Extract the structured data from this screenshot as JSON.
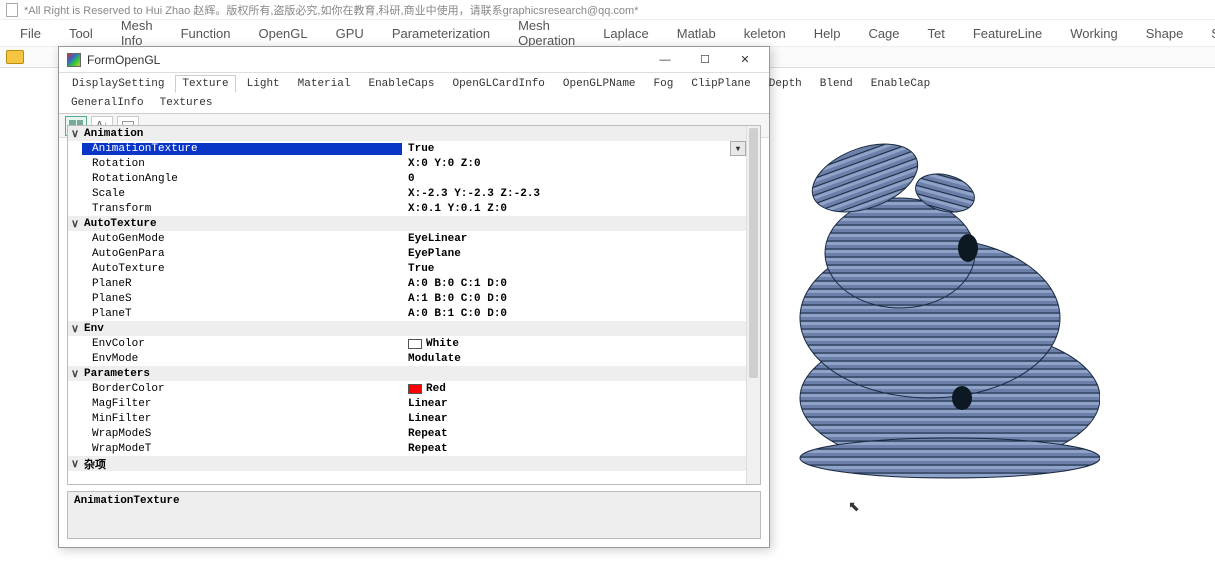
{
  "app": {
    "title_text": "*All Right is Reserved to Hui Zhao 赵辉。版权所有,盗版必究,如你在教育,科研,商业中使用，请联系graphicsresearch@qq.com*"
  },
  "menubar": [
    "File",
    "Tool",
    "Mesh Info",
    "Function",
    "OpenGL",
    "GPU",
    "Parameterization",
    "Mesh Operation",
    "Laplace",
    "Matlab",
    "keleton",
    "Help",
    "Cage",
    "Tet",
    "FeatureLine",
    "Working",
    "Shape",
    "Skinn"
  ],
  "dialog": {
    "title": "FormOpenGL",
    "tabs": [
      "DisplaySetting",
      "Texture",
      "Light",
      "Material",
      "EnableCaps",
      "OpenGLCardInfo",
      "OpenGLPName",
      "Fog",
      "ClipPlane",
      "Depth",
      "Blend",
      "EnableCap"
    ],
    "active_tab": "Texture",
    "subtabs": [
      "GeneralInfo",
      "Textures"
    ],
    "winbtns": {
      "min": "—",
      "max": "☐",
      "close": "✕"
    }
  },
  "props": [
    {
      "type": "cat",
      "exp": "∨",
      "name": "Animation"
    },
    {
      "type": "row",
      "name": "AnimationTexture",
      "value": "True",
      "selected": true,
      "dropdown": true
    },
    {
      "type": "row",
      "name": "Rotation",
      "value": "X:0 Y:0 Z:0"
    },
    {
      "type": "row",
      "name": "RotationAngle",
      "value": "0"
    },
    {
      "type": "row",
      "name": "Scale",
      "value": "X:-2.3 Y:-2.3 Z:-2.3"
    },
    {
      "type": "row",
      "name": "Transform",
      "value": "X:0.1 Y:0.1 Z:0"
    },
    {
      "type": "cat",
      "exp": "∨",
      "name": "AutoTexture"
    },
    {
      "type": "row",
      "name": "AutoGenMode",
      "value": "EyeLinear"
    },
    {
      "type": "row",
      "name": "AutoGenPara",
      "value": "EyePlane"
    },
    {
      "type": "row",
      "name": "AutoTexture",
      "value": "True"
    },
    {
      "type": "row",
      "name": "PlaneR",
      "value": "A:0 B:0 C:1 D:0"
    },
    {
      "type": "row",
      "name": "PlaneS",
      "value": "A:1 B:0 C:0 D:0"
    },
    {
      "type": "row",
      "name": "PlaneT",
      "value": "A:0 B:1 C:0 D:0"
    },
    {
      "type": "cat",
      "exp": "∨",
      "name": "Env"
    },
    {
      "type": "row",
      "name": "EnvColor",
      "value": "White",
      "swatch": "#ffffff"
    },
    {
      "type": "row",
      "name": "EnvMode",
      "value": "Modulate"
    },
    {
      "type": "cat",
      "exp": "∨",
      "name": "Parameters"
    },
    {
      "type": "row",
      "name": "BorderColor",
      "value": "Red",
      "swatch": "#ff0000"
    },
    {
      "type": "row",
      "name": "MagFilter",
      "value": "Linear"
    },
    {
      "type": "row",
      "name": "MinFilter",
      "value": "Linear"
    },
    {
      "type": "row",
      "name": "WrapModeS",
      "value": "Repeat"
    },
    {
      "type": "row",
      "name": "WrapModeT",
      "value": "Repeat"
    },
    {
      "type": "cat",
      "exp": "∨",
      "name": "杂项"
    }
  ],
  "desc": {
    "title": "AnimationTexture"
  }
}
